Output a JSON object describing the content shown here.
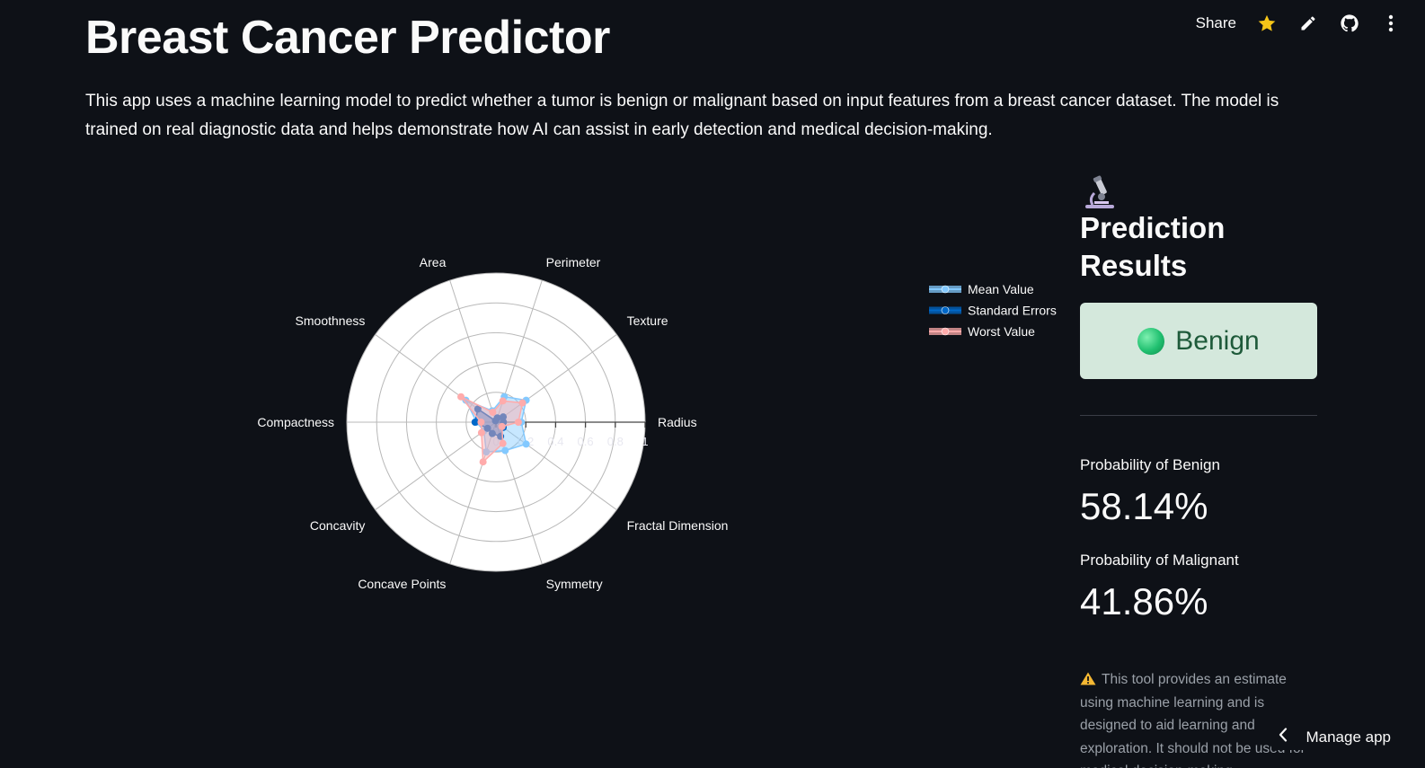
{
  "toolbar": {
    "share_label": "Share",
    "icons": [
      "star-icon",
      "pencil-icon",
      "github-icon",
      "more-vertical-icon"
    ],
    "star_color": "#f5c518"
  },
  "header": {
    "title": "Breast Cancer Predictor",
    "description": "This app uses a machine learning model to predict whether a tumor is benign or malignant based on input features from a breast cancer dataset. The model is trained on real diagnostic data and helps demonstrate how AI can assist in early detection and medical decision-making."
  },
  "chart_data": {
    "type": "radar",
    "categories": [
      "Radius",
      "Texture",
      "Perimeter",
      "Area",
      "Smoothness",
      "Compactness",
      "Concavity",
      "Concave Points",
      "Symmetry",
      "Fractal Dimension"
    ],
    "radial_ticks": [
      "0",
      "0.2",
      "0.4",
      "0.6",
      "0.8",
      "1"
    ],
    "range": [
      0,
      1
    ],
    "series": [
      {
        "name": "Mean Value",
        "color": "#83c9ff",
        "values": [
          0.17,
          0.25,
          0.18,
          0.08,
          0.25,
          0.13,
          0.1,
          0.21,
          0.2,
          0.25
        ]
      },
      {
        "name": "Standard Errors",
        "color": "#0068c9",
        "values": [
          0.05,
          0.06,
          0.03,
          0.01,
          0.15,
          0.14,
          0.07,
          0.08,
          0.1,
          0.06
        ]
      },
      {
        "name": "Worst Value",
        "color": "#ffabab",
        "values": [
          0.15,
          0.22,
          0.15,
          0.07,
          0.29,
          0.1,
          0.12,
          0.28,
          0.15,
          0.05
        ]
      }
    ],
    "legend_position": "right",
    "background": "#ffffff",
    "grid": true
  },
  "results": {
    "heading": "Prediction Results",
    "heading_icon": "microscope-icon",
    "label": "Benign",
    "box_color": "#d4e8dc",
    "benign_label": "Probability of Benign",
    "benign_value": "58.14%",
    "malignant_label": "Probability of Malignant",
    "malignant_value": "41.86%",
    "disclaimer": "This tool provides an estimate using machine learning and is designed to aid learning and exploration. It should not be used for medical decision-making."
  },
  "footer": {
    "manage_label": "Manage app"
  }
}
